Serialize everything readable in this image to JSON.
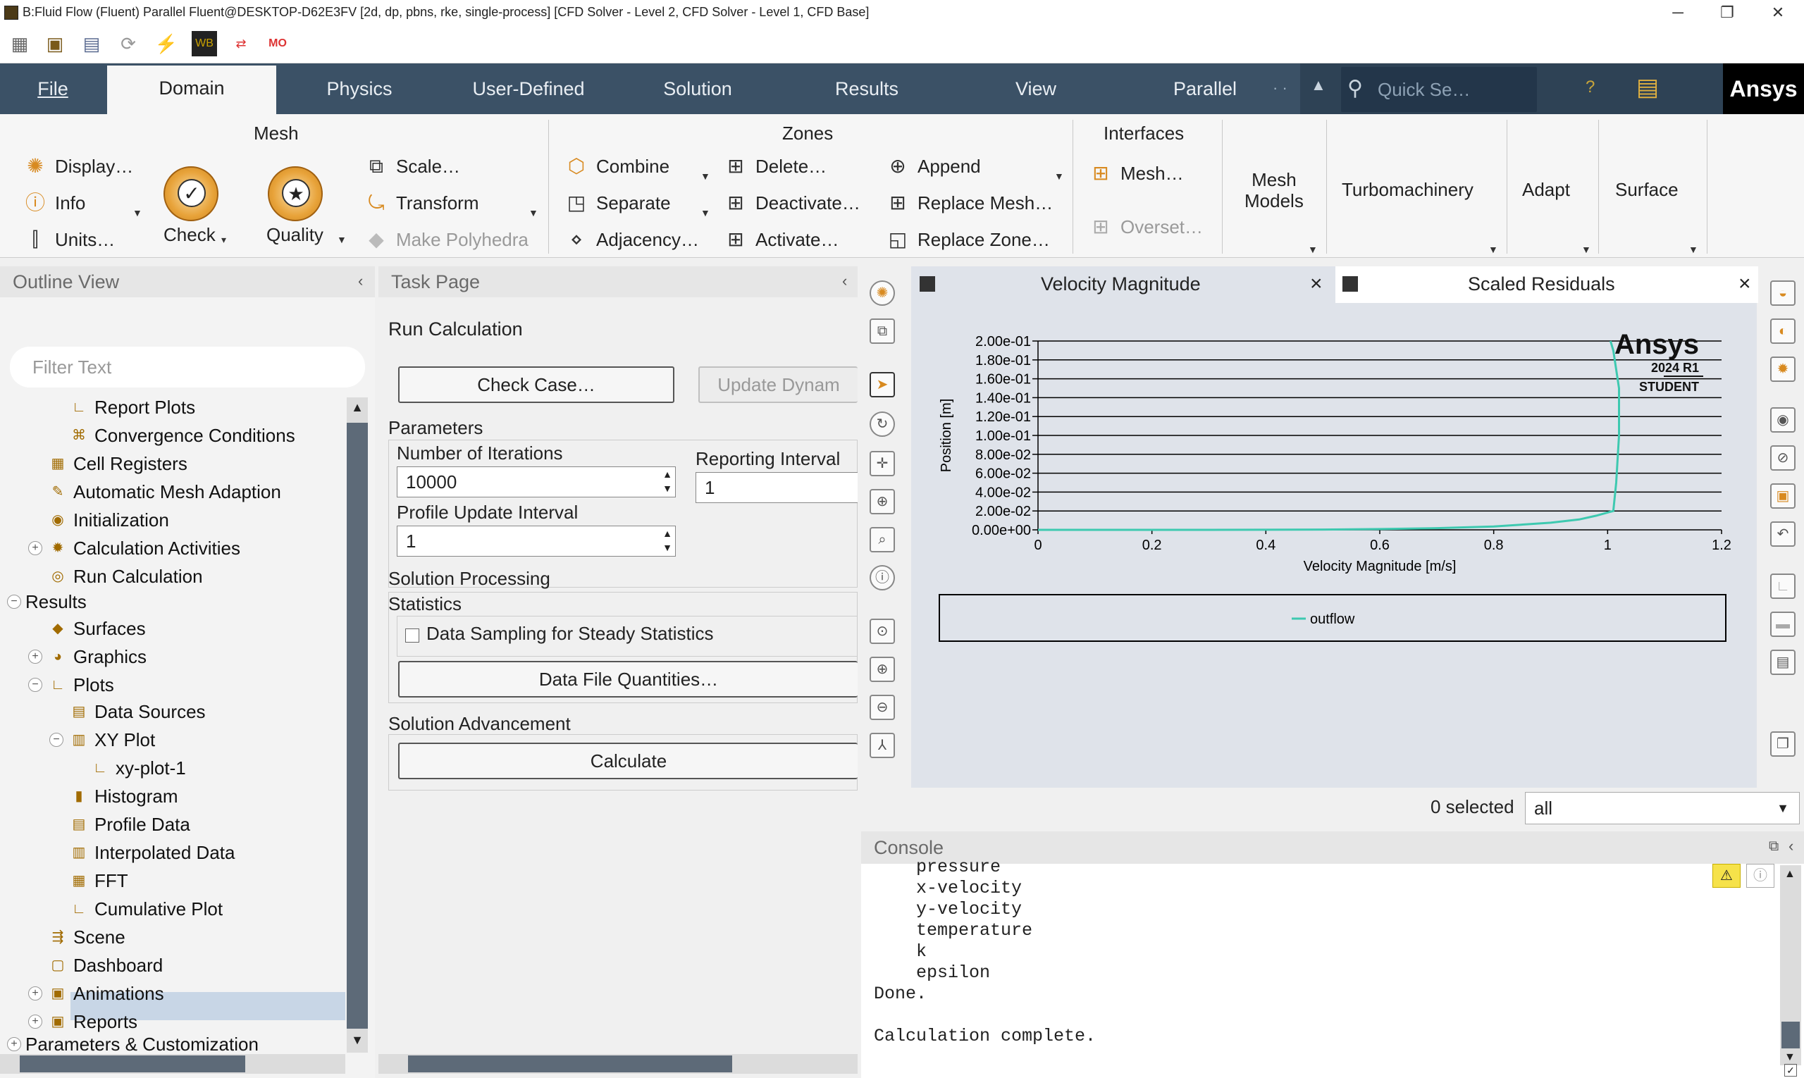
{
  "window": {
    "title": "B:Fluid Flow (Fluent) Parallel Fluent@DESKTOP-D62E3FV  [2d, dp, pbns, rke, single-process] [CFD Solver - Level 2, CFD Solver - Level 1, CFD Base]",
    "minimize": "─",
    "maximize": "❐",
    "close": "✕"
  },
  "ribbon_tabs": [
    "File",
    "Domain",
    "Physics",
    "User-Defined",
    "Solution",
    "Results",
    "View",
    "Parallel"
  ],
  "quick_search_placeholder": "Quick Se…",
  "brand": "Ansys",
  "ribbon": {
    "mesh": {
      "title": "Mesh",
      "display": "Display…",
      "info": "Info",
      "units": "Units…",
      "check": "Check",
      "quality": "Quality",
      "scale": "Scale…",
      "transform": "Transform",
      "make_polyhedra": "Make Polyhedra"
    },
    "zones": {
      "title": "Zones",
      "combine": "Combine",
      "separate": "Separate",
      "adjacency": "Adjacency…",
      "delete": "Delete…",
      "deactivate": "Deactivate…",
      "activate": "Activate…",
      "append": "Append",
      "replace_mesh": "Replace Mesh…",
      "replace_zone": "Replace Zone…"
    },
    "interfaces": {
      "title": "Interfaces",
      "mesh": "Mesh…",
      "overset": "Overset…"
    },
    "mesh_models": "Mesh\nModels",
    "turbomachinery": "Turbomachinery",
    "adapt": "Adapt",
    "surface": "Surface"
  },
  "outline": {
    "title": "Outline View",
    "filter_placeholder": "Filter Text",
    "items": [
      {
        "label": "Report Plots",
        "icon": "line-chart-icon"
      },
      {
        "label": "Convergence Conditions",
        "icon": "convergence-icon"
      },
      {
        "label": "Cell Registers",
        "icon": "registers-icon"
      },
      {
        "label": "Automatic Mesh Adaption",
        "icon": "adaption-icon"
      },
      {
        "label": "Initialization",
        "icon": "initialization-icon"
      },
      {
        "label": "Calculation Activities",
        "icon": "activities-icon"
      },
      {
        "label": "Run Calculation",
        "icon": "run-icon"
      },
      {
        "label": "Results",
        "icon": ""
      },
      {
        "label": "Surfaces",
        "icon": "surfaces-icon"
      },
      {
        "label": "Graphics",
        "icon": "graphics-icon"
      },
      {
        "label": "Plots",
        "icon": "plots-icon"
      },
      {
        "label": "Data Sources",
        "icon": "data-sources-icon"
      },
      {
        "label": "XY Plot",
        "icon": "xy-plot-icon"
      },
      {
        "label": "xy-plot-1",
        "icon": "plot-instance-icon"
      },
      {
        "label": "Histogram",
        "icon": "histogram-icon"
      },
      {
        "label": "Profile Data",
        "icon": "profile-icon"
      },
      {
        "label": "Interpolated Data",
        "icon": "interpolated-icon"
      },
      {
        "label": "FFT",
        "icon": "fft-icon"
      },
      {
        "label": "Cumulative Plot",
        "icon": "cumulative-icon"
      },
      {
        "label": "Scene",
        "icon": "scene-icon"
      },
      {
        "label": "Dashboard",
        "icon": "dashboard-icon"
      },
      {
        "label": "Animations",
        "icon": "animations-icon"
      },
      {
        "label": "Reports",
        "icon": "reports-icon"
      },
      {
        "label": "Parameters & Customization",
        "icon": ""
      }
    ]
  },
  "task": {
    "title": "Task Page",
    "heading": "Run Calculation",
    "check_case": "Check Case…",
    "update_dynamic": "Update Dynam",
    "parameters": "Parameters",
    "num_iter_label": "Number of Iterations",
    "num_iter_value": "10000",
    "reporting_label": "Reporting Interval",
    "reporting_value": "1",
    "profile_label": "Profile Update Interval",
    "profile_value": "1",
    "solution_processing": "Solution Processing",
    "statistics": "Statistics",
    "data_sampling": "Data Sampling for Steady Statistics",
    "data_file_quantities": "Data File Quantities…",
    "solution_advancement": "Solution Advancement",
    "calculate": "Calculate"
  },
  "graphics_tabs": [
    {
      "label": "Velocity Magnitude",
      "close": "×"
    },
    {
      "label": "Scaled Residuals",
      "close": "×"
    }
  ],
  "watermark": {
    "brand": "Ansys",
    "version": "2024 R1",
    "edition": "STUDENT"
  },
  "chart_data": {
    "type": "line",
    "title": "",
    "xlabel": "Velocity Magnitude [m/s]",
    "ylabel": "Position [m]",
    "xlim": [
      0,
      1.2
    ],
    "ylim": [
      0,
      0.2
    ],
    "x_ticks": [
      "0",
      "0.2",
      "0.4",
      "0.6",
      "0.8",
      "1",
      "1.2"
    ],
    "y_ticks": [
      "0.00e+00",
      "2.00e-02",
      "4.00e-02",
      "6.00e-02",
      "8.00e-02",
      "1.00e-01",
      "1.20e-01",
      "1.40e-01",
      "1.60e-01",
      "1.80e-01",
      "2.00e-01"
    ],
    "grid": "horizontal",
    "legend": "bottom",
    "series": [
      {
        "name": "outflow",
        "color": "#3ec9b0",
        "x": [
          0,
          0.3,
          0.5,
          0.6,
          0.7,
          0.8,
          0.9,
          0.95,
          0.98,
          1.01,
          1.015,
          1.02,
          1.02,
          1.01,
          1.005
        ],
        "y": [
          0,
          0,
          0.0003,
          0.0008,
          0.0018,
          0.0035,
          0.0075,
          0.011,
          0.015,
          0.02,
          0.05,
          0.1,
          0.15,
          0.19,
          0.2
        ]
      }
    ]
  },
  "selection": {
    "count_label": "0 selected",
    "filter_value": "all"
  },
  "console": {
    "title": "Console",
    "lines": [
      "    pressure",
      "    x-velocity",
      "    y-velocity",
      "    temperature",
      "    k",
      "    epsilon",
      "Done.",
      "",
      "Calculation complete."
    ]
  }
}
